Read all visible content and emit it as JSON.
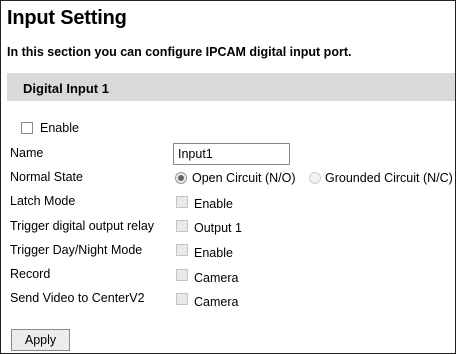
{
  "page": {
    "title": "Input Setting",
    "subtitle": "In this section you can configure IPCAM digital input port."
  },
  "section": {
    "title": "Digital Input 1"
  },
  "enable": {
    "label": "Enable",
    "checked": false
  },
  "name": {
    "label": "Name",
    "value": "Input1"
  },
  "normal_state": {
    "label": "Normal State",
    "options": [
      {
        "label": "Open Circuit (N/O)",
        "selected": true
      },
      {
        "label": "Grounded Circuit (N/C)",
        "selected": false
      }
    ]
  },
  "latch_mode": {
    "label": "Latch Mode",
    "option": "Enable",
    "checked": false
  },
  "trigger_output": {
    "label": "Trigger digital output relay",
    "option": "Output 1",
    "checked": false
  },
  "trigger_daynight": {
    "label": "Trigger Day/Night Mode",
    "option": "Enable",
    "checked": false
  },
  "record": {
    "label": "Record",
    "option": "Camera",
    "checked": false
  },
  "send_video": {
    "label": "Send Video to CenterV2",
    "option": "Camera",
    "checked": false
  },
  "apply": {
    "label": "Apply"
  }
}
